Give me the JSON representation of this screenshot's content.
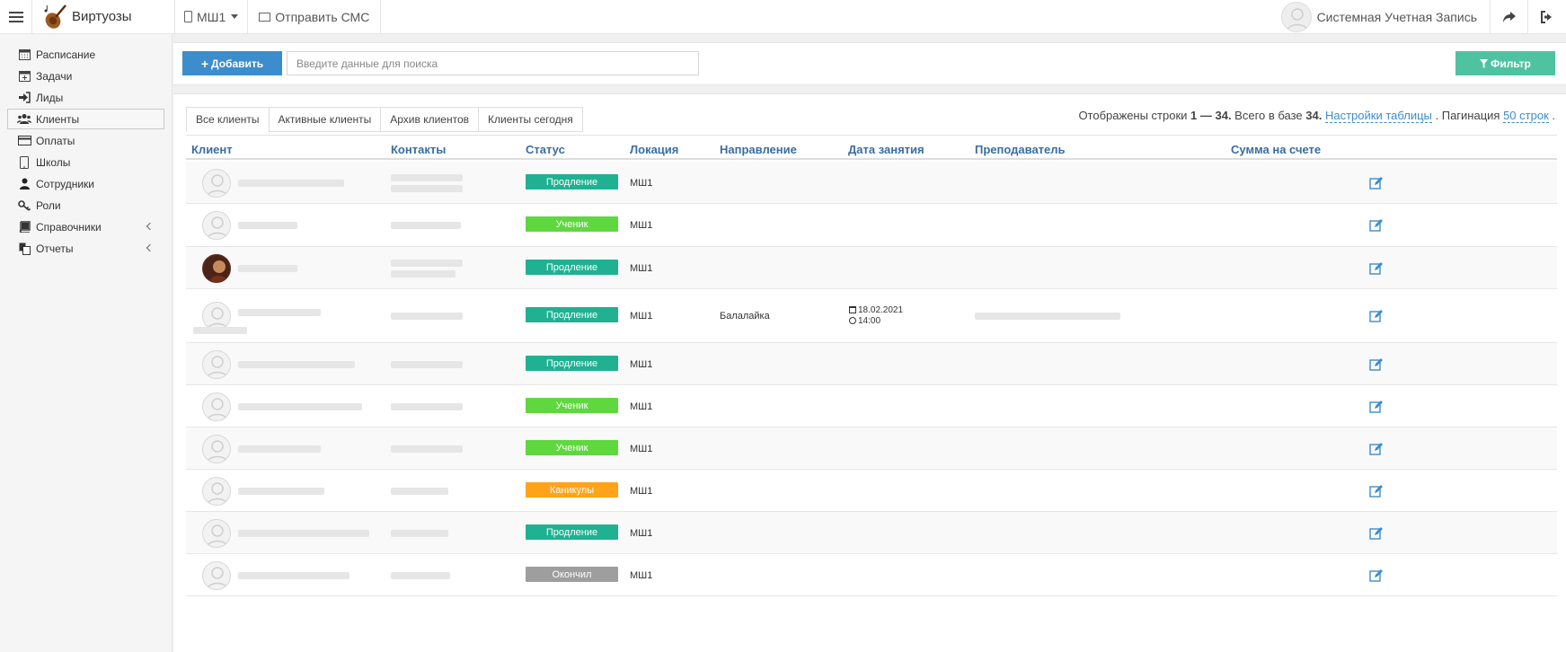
{
  "topbar": {
    "brand": "Виртуозы",
    "school": "МШ1",
    "sms": "Отправить СМС",
    "user": "Системная Учетная Запись"
  },
  "sidebar": {
    "items": [
      {
        "label": "Расписание",
        "icon": "calendar-icon"
      },
      {
        "label": "Задачи",
        "icon": "task-calendar-icon"
      },
      {
        "label": "Лиды",
        "icon": "sign-in-icon"
      },
      {
        "label": "Клиенты",
        "icon": "users-icon"
      },
      {
        "label": "Оплаты",
        "icon": "credit-card-icon"
      },
      {
        "label": "Школы",
        "icon": "building-icon"
      },
      {
        "label": "Сотрудники",
        "icon": "user-icon"
      },
      {
        "label": "Роли",
        "icon": "key-icon"
      },
      {
        "label": "Справочники",
        "icon": "book-icon"
      },
      {
        "label": "Отчеты",
        "icon": "copy-icon"
      }
    ]
  },
  "toolbar": {
    "add_label": "Добавить",
    "search_placeholder": "Введите данные для поиска",
    "filter_label": "Фильтр"
  },
  "tabs": [
    "Все клиенты",
    "Активные клиенты",
    "Архив клиентов",
    "Клиенты сегодня"
  ],
  "info": {
    "prefix": "Отображены строки ",
    "range": "1 — 34.",
    "total_prefix": " Всего в базе ",
    "total": "34.",
    "settings_link": "Настройки таблицы",
    "sep": " . Пагинация ",
    "pagination_link": "50 строк",
    "end": " ."
  },
  "columns": [
    "Клиент",
    "Контакты",
    "Статус",
    "Локация",
    "Направление",
    "Дата занятия",
    "Преподаватель",
    "Сумма на счете"
  ],
  "rows": [
    {
      "status": "Продление",
      "status_class": "st-prod",
      "location": "МШ1",
      "direction": "",
      "date": "",
      "time": ""
    },
    {
      "status": "Ученик",
      "status_class": "st-uch",
      "location": "МШ1",
      "direction": "",
      "date": "",
      "time": ""
    },
    {
      "status": "Продление",
      "status_class": "st-prod",
      "location": "МШ1",
      "direction": "",
      "date": "",
      "time": ""
    },
    {
      "status": "Продление",
      "status_class": "st-prod",
      "location": "МШ1",
      "direction": "Балалайка",
      "date": "18.02.2021",
      "time": "14:00"
    },
    {
      "status": "Продление",
      "status_class": "st-prod",
      "location": "МШ1",
      "direction": "",
      "date": "",
      "time": ""
    },
    {
      "status": "Ученик",
      "status_class": "st-uch",
      "location": "МШ1",
      "direction": "",
      "date": "",
      "time": ""
    },
    {
      "status": "Ученик",
      "status_class": "st-uch",
      "location": "МШ1",
      "direction": "",
      "date": "",
      "time": ""
    },
    {
      "status": "Каникулы",
      "status_class": "st-kan",
      "location": "МШ1",
      "direction": "",
      "date": "",
      "time": ""
    },
    {
      "status": "Продление",
      "status_class": "st-prod",
      "location": "МШ1",
      "direction": "",
      "date": "",
      "time": ""
    },
    {
      "status": "Окончил",
      "status_class": "st-ok",
      "location": "МШ1",
      "direction": "",
      "date": "",
      "time": ""
    }
  ]
}
